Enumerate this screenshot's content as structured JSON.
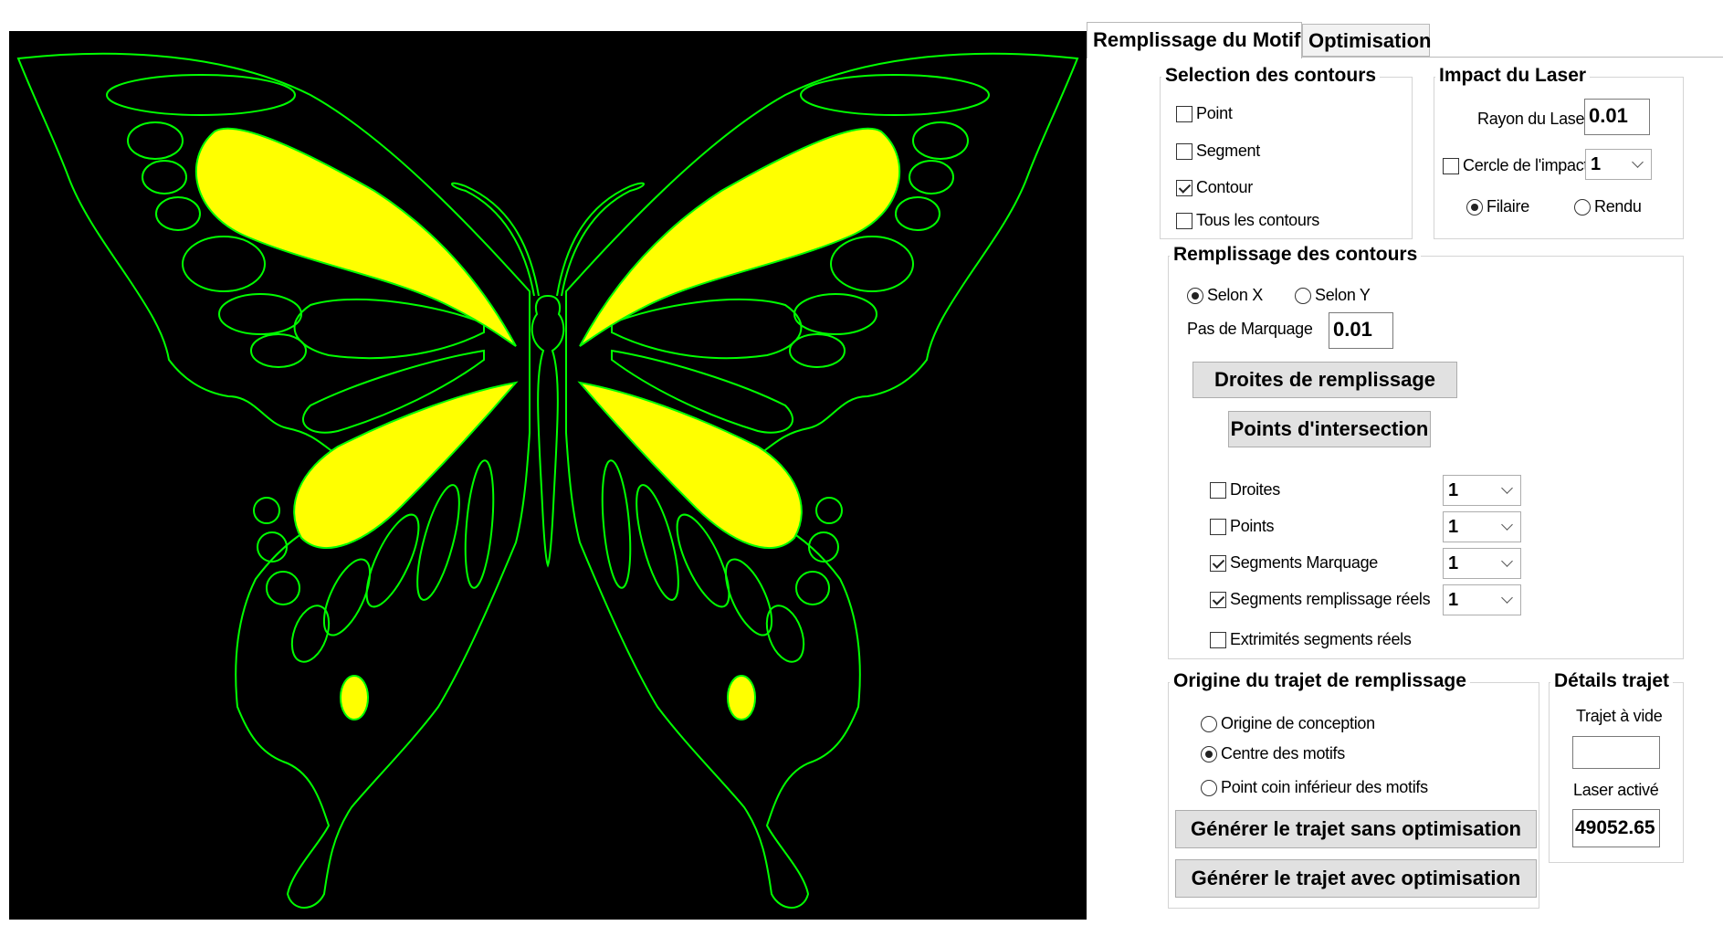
{
  "canvas": {
    "background": "#000000",
    "outline_color": "#00ff00",
    "fill_color": "#ffff00"
  },
  "tabs": [
    {
      "label": "Remplissage du Motif",
      "active": true
    },
    {
      "label": "Optimisation",
      "active": false
    }
  ],
  "selection": {
    "title": "Selection des contours",
    "items": [
      {
        "label": "Point",
        "checked": false
      },
      {
        "label": "Segment",
        "checked": false
      },
      {
        "label": "Contour",
        "checked": true
      },
      {
        "label": "Tous les contours",
        "checked": false
      }
    ]
  },
  "impact": {
    "title": "Impact du Laser",
    "rayon_label": "Rayon du Laser",
    "rayon_value": "0.01",
    "cercle_label": "Cercle de l'impact",
    "cercle_checked": false,
    "cercle_value": "1",
    "filaire_label": "Filaire",
    "rendu_label": "Rendu",
    "selected": "filaire"
  },
  "remplissage": {
    "title": "Remplissage des contours",
    "selon_x_label": "Selon X",
    "selon_y_label": "Selon Y",
    "selected": "x",
    "pas_label": "Pas de Marquage",
    "pas_value": "0.01",
    "droites_button": "Droites de remplissage",
    "points_button": "Points d'intersection",
    "options": [
      {
        "label": "Droites",
        "checked": false,
        "value": "1"
      },
      {
        "label": "Points",
        "checked": false,
        "value": "1"
      },
      {
        "label": "Segments Marquage",
        "checked": true,
        "value": "1"
      },
      {
        "label": "Segments remplissage réels",
        "checked": true,
        "value": "1"
      }
    ],
    "extremites_label": "Extrimités segments réels",
    "extremites_checked": false
  },
  "origine": {
    "title": "Origine du trajet de remplissage",
    "options": [
      {
        "label": "Origine de conception",
        "selected": false
      },
      {
        "label": "Centre des motifs",
        "selected": true
      },
      {
        "label": "Point coin inférieur des motifs",
        "selected": false
      }
    ],
    "btn_sans": "Générer le trajet sans optimisation",
    "btn_avec": "Générer le trajet avec optimisation"
  },
  "details": {
    "title": "Détails trajet",
    "vide_label": "Trajet à vide",
    "vide_value": "",
    "laser_label": "Laser activé",
    "laser_value": "49052.65"
  }
}
